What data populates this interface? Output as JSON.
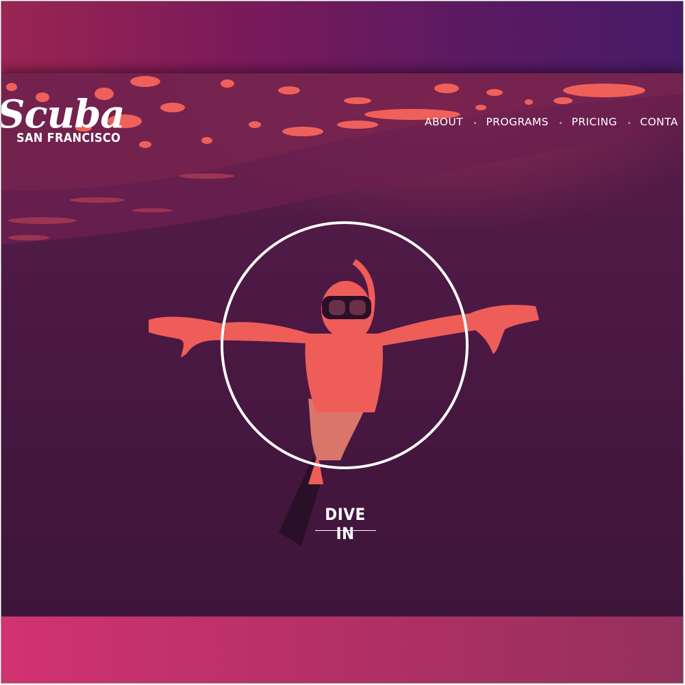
{
  "brand": {
    "script": "Scuba",
    "subtitle": "SAN FRANCISCO"
  },
  "nav": {
    "items": [
      "ABOUT",
      "PROGRAMS",
      "PRICING",
      "CONTA"
    ]
  },
  "hero": {
    "cta_label": "DIVE IN"
  },
  "colors": {
    "accent": "#f0605a",
    "hero_bg": "#4f1a46",
    "top_band": "#7a1a5a",
    "bottom_band": "#c1336a"
  },
  "icons": {
    "hero_ring": "circle-ring-icon"
  }
}
